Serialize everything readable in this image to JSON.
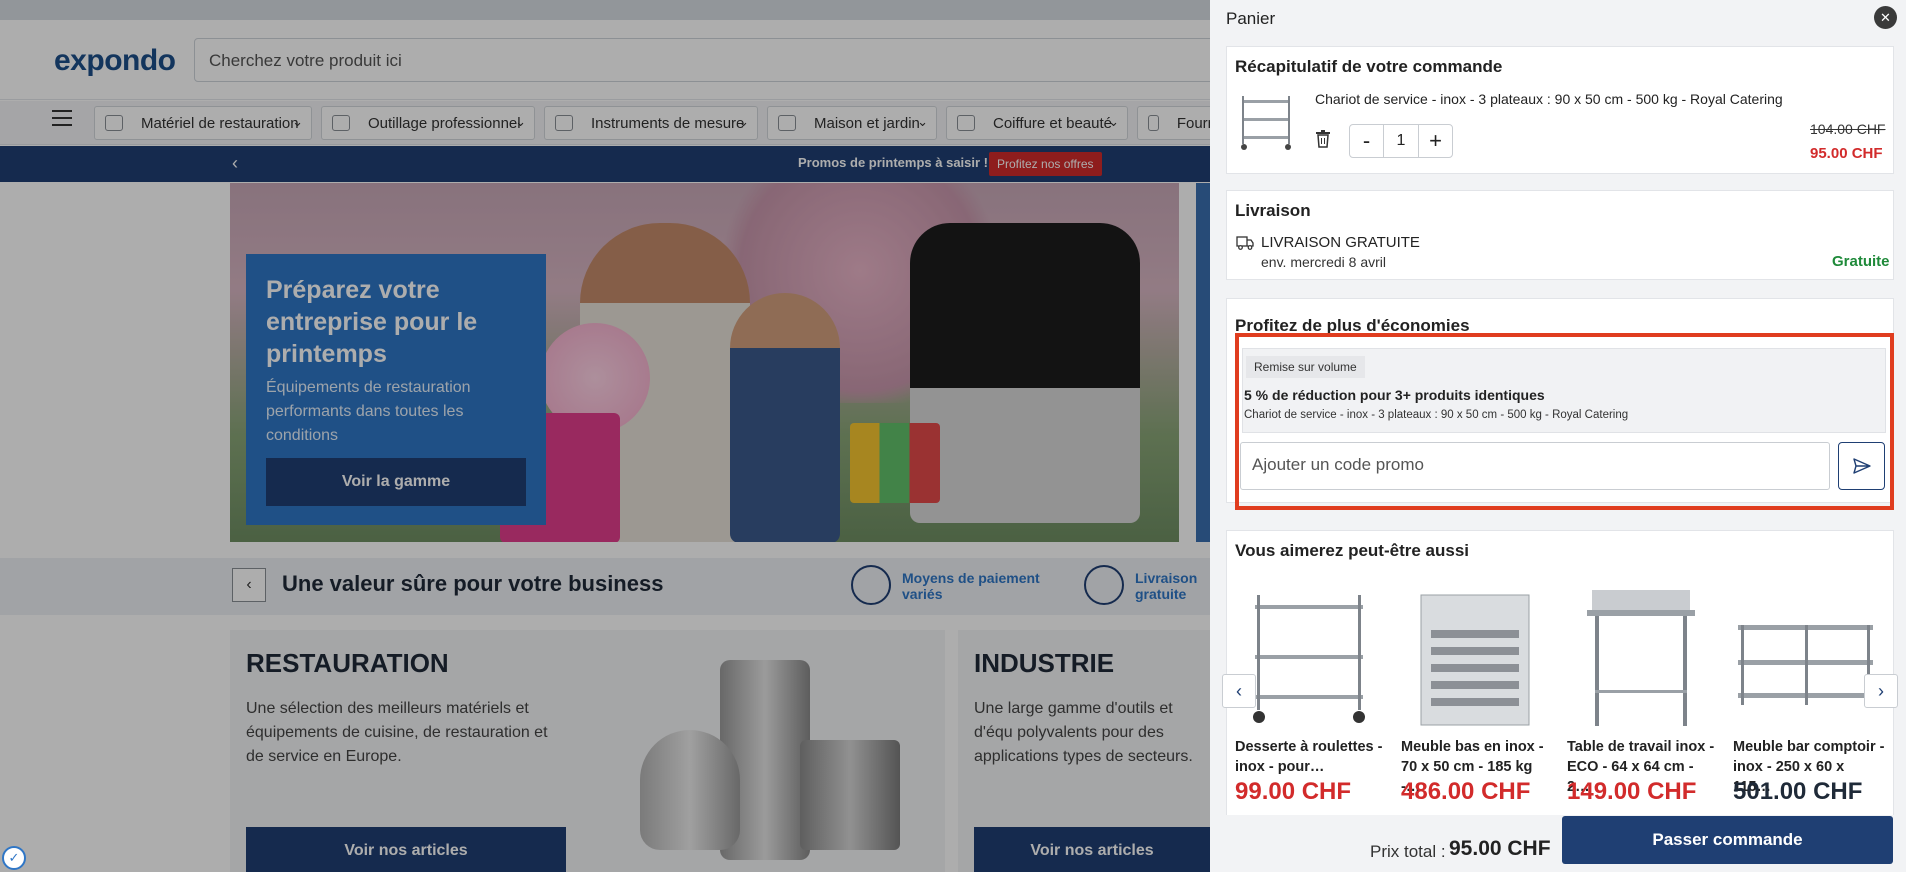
{
  "site": {
    "logo": "expondo",
    "search_placeholder": "Cherchez votre produit ici"
  },
  "categories": [
    "Matériel de restauration",
    "Outillage professionnel",
    "Instruments de mesure",
    "Maison et jardin",
    "Coiffure et beauté",
    "Fourn"
  ],
  "promo_bar": {
    "text": "Promos de printemps à saisir !",
    "button": "Profitez nos offres",
    "prev": "‹"
  },
  "hero": {
    "title": "Préparez votre entreprise pour le printemps",
    "subtitle": "Équipements de restauration performants dans toutes les conditions",
    "button": "Voir la gamme"
  },
  "value_band": {
    "prev": "‹",
    "title": "Une valeur sûre pour votre business",
    "features": [
      {
        "label": "Moyens de paiement variés",
        "icon": "wallet-icon"
      },
      {
        "label": "Livraison gratuite",
        "icon": "delivery-icon"
      }
    ]
  },
  "sections": [
    {
      "title": "RESTAURATION",
      "text": "Une sélection des meilleurs matériels et équipements de cuisine, de restauration et de service en Europe.",
      "button": "Voir nos articles"
    },
    {
      "title": "INDUSTRIE",
      "text": "Une large gamme d'outils et d'équ polyvalents pour des applications types de secteurs.",
      "button": "Voir nos articles"
    }
  ],
  "cart": {
    "title": "Panier",
    "close_icon": "close-icon",
    "summary": {
      "heading": "Récapitulatif de votre commande",
      "item_name": "Chariot de service - inox - 3 plateaux : 90 x 50 cm - 500 kg - Royal Catering",
      "quantity": "1",
      "minus": "-",
      "plus": "+",
      "price_old": "104.00 CHF",
      "price_new": "95.00 CHF"
    },
    "delivery": {
      "heading": "Livraison",
      "method": "LIVRAISON GRATUITE",
      "date": "env. mercredi 8 avril",
      "cost": "Gratuite"
    },
    "savings": {
      "heading": "Profitez de plus d'économies",
      "badge": "Remise sur volume",
      "offer": "5 % de réduction pour 3+ produits identiques",
      "offer_product": "Chariot de service - inox - 3 plateaux : 90 x 50 cm - 500 kg - Royal Catering",
      "promo_placeholder": "Ajouter un code promo"
    },
    "recommendations": {
      "heading": "Vous aimerez peut-être aussi",
      "prev": "‹",
      "next": "›",
      "products": [
        {
          "name_line1": "Desserte à roulettes -",
          "name_line2": "inox - pour…",
          "price": "99.00 CHF",
          "price_color": "#d22b2b"
        },
        {
          "name_line1": "Meuble bas en inox -",
          "name_line2": "70 x 50 cm - 185 kg -…",
          "price": "486.00 CHF",
          "price_color": "#d22b2b"
        },
        {
          "name_line1": "Table de travail inox -",
          "name_line2": "ECO - 64 x 64 cm - 2…",
          "price": "149.00 CHF",
          "price_color": "#d22b2b"
        },
        {
          "name_line1": "Meuble bar comptoir -",
          "name_line2": "inox - 250 x 60 x 115…",
          "price": "501.00 CHF",
          "price_color": "#1f2a38"
        }
      ]
    },
    "total_label": "Prix total :",
    "total_value": "95.00 CHF",
    "checkout_button": "Passer commande"
  }
}
